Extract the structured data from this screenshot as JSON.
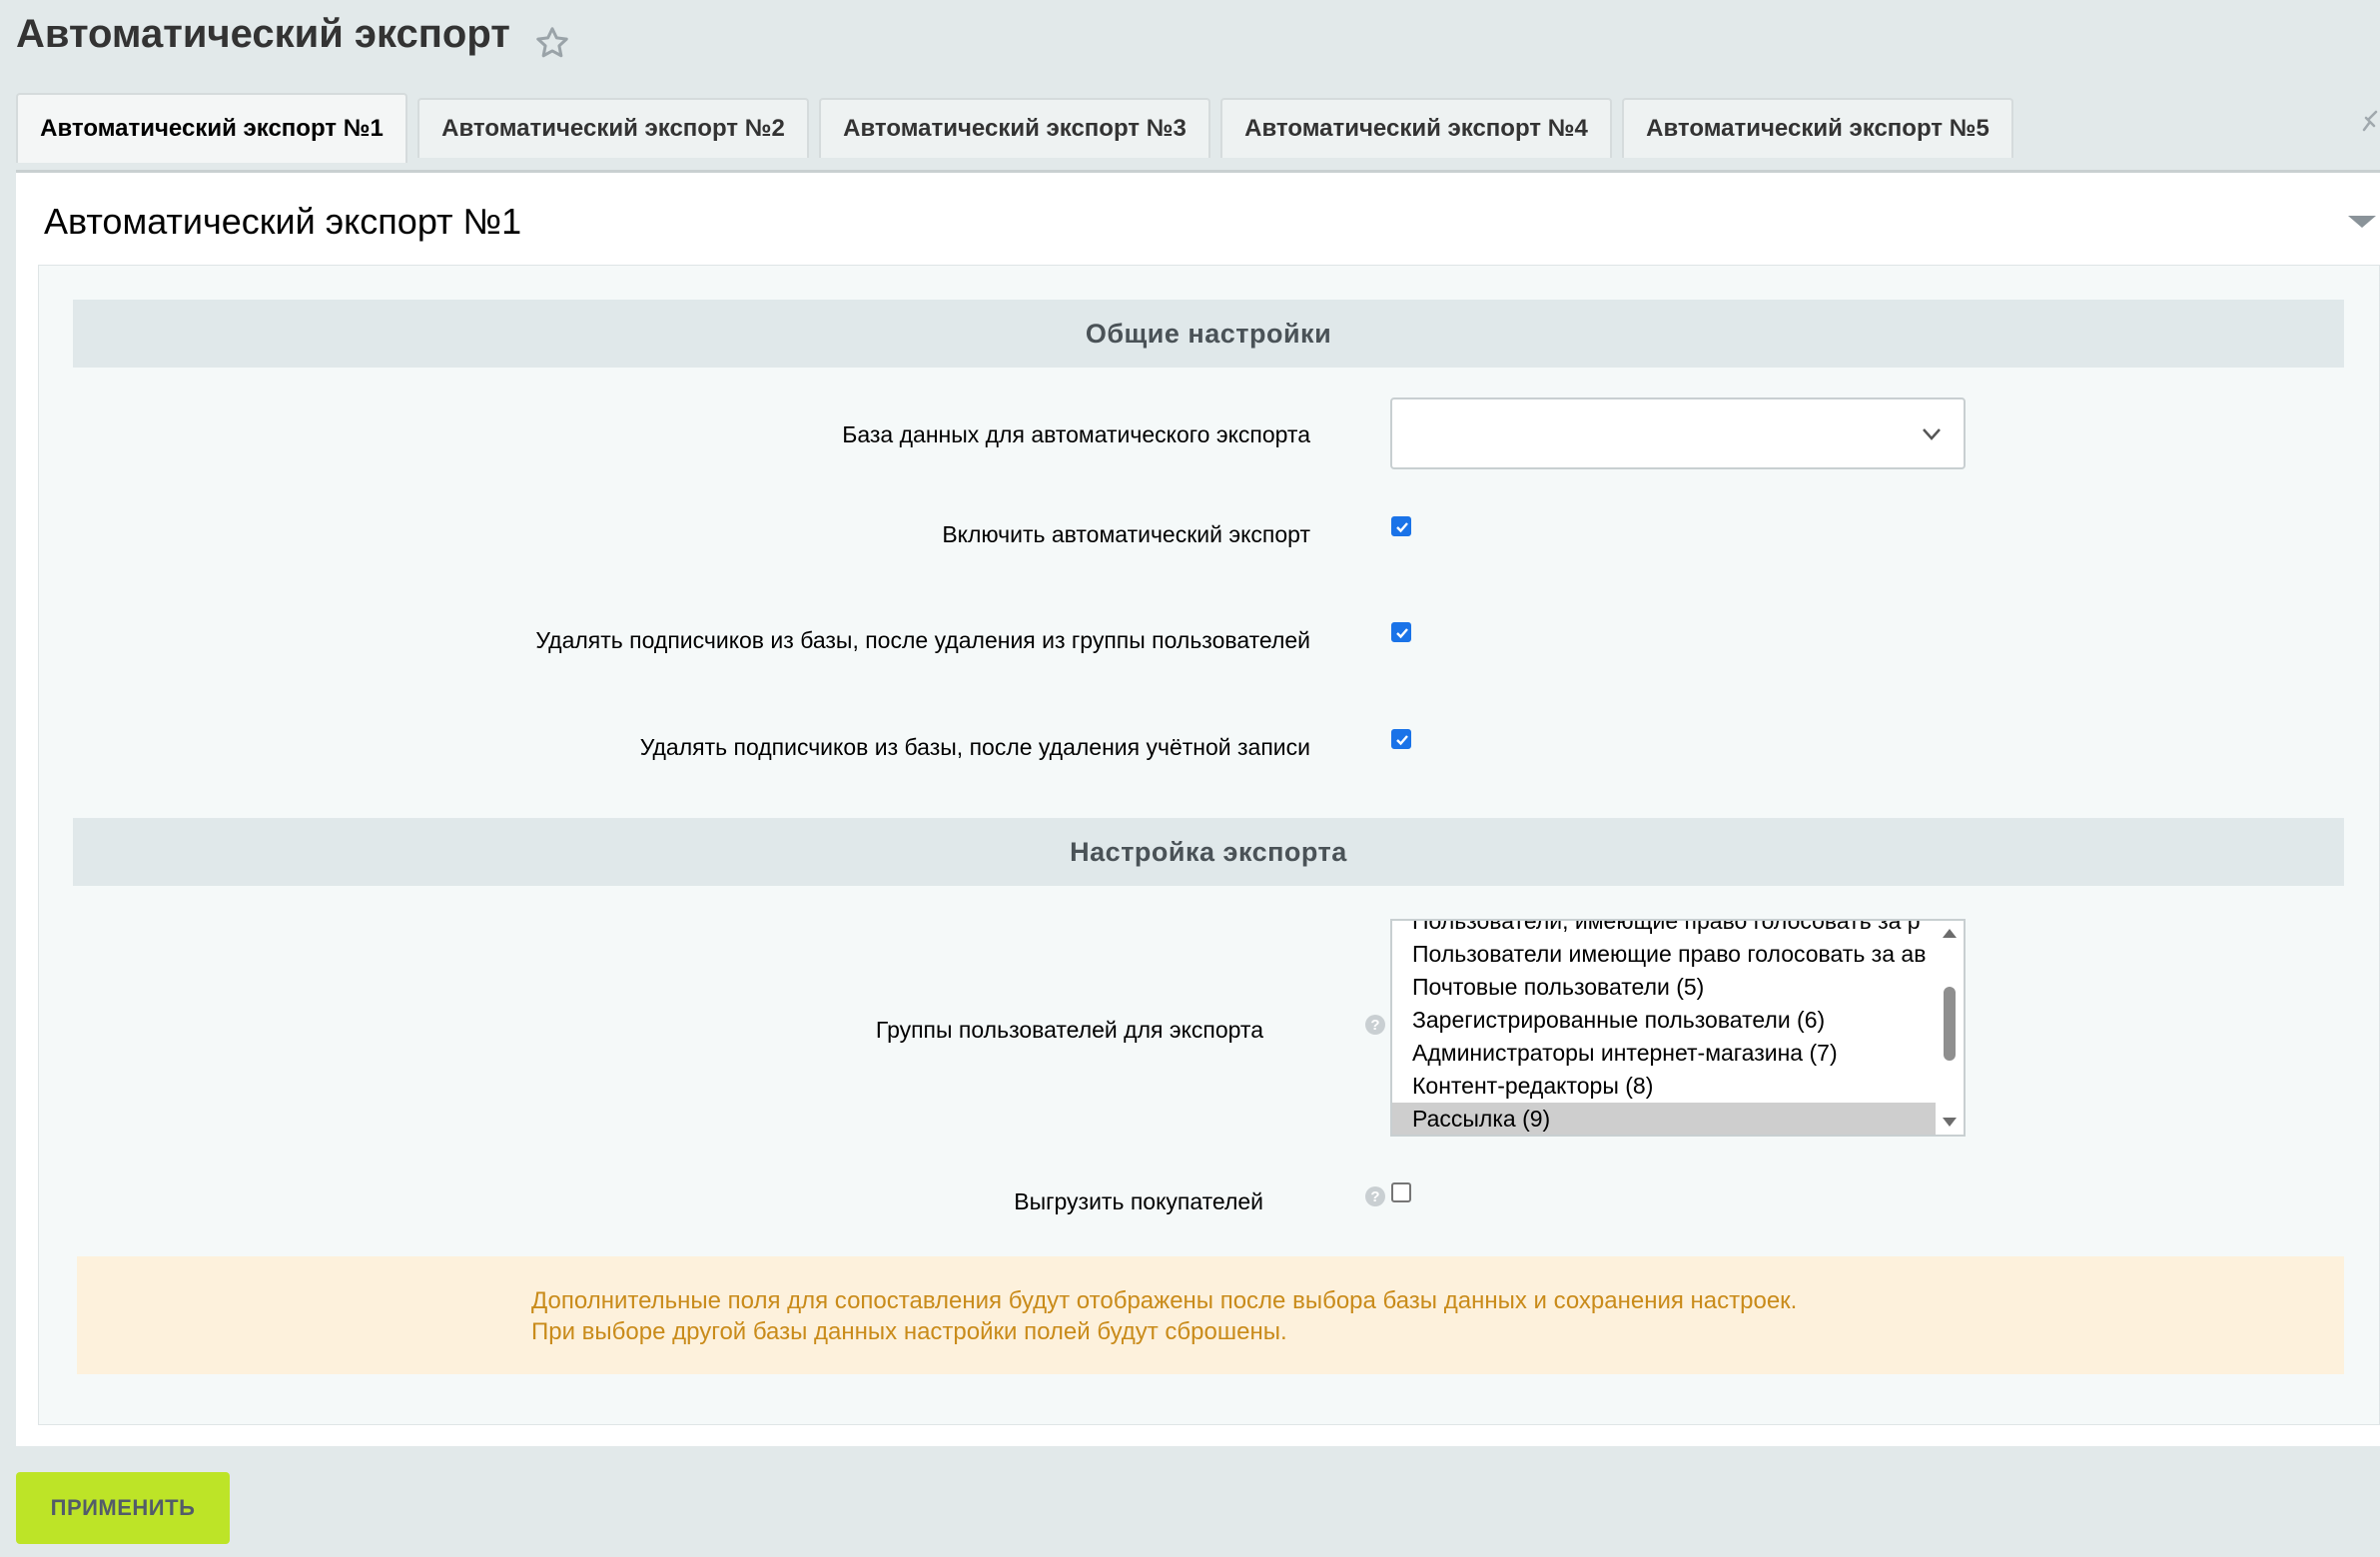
{
  "page": {
    "title": "Автоматический экспорт"
  },
  "tabs": [
    {
      "label": "Автоматический экспорт №1",
      "active": true
    },
    {
      "label": "Автоматический экспорт №2",
      "active": false
    },
    {
      "label": "Автоматический экспорт №3",
      "active": false
    },
    {
      "label": "Автоматический экспорт №4",
      "active": false
    },
    {
      "label": "Автоматический экспорт №5",
      "active": false
    }
  ],
  "panel": {
    "title": "Автоматический экспорт №1",
    "sections": {
      "general": "Общие настройки",
      "export": "Настройка экспорта"
    },
    "fields": {
      "database": {
        "label": "База данных для автоматического экспорта",
        "value": ""
      },
      "enable_export": {
        "label": "Включить автоматический экспорт",
        "checked": true
      },
      "delete_on_group_removal": {
        "label": "Удалять подписчиков из базы, после удаления из группы пользователей",
        "checked": true
      },
      "delete_on_account_removal": {
        "label": "Удалять подписчиков из базы, после удаления учётной записи",
        "checked": true
      },
      "user_groups": {
        "label": "Группы пользователей для экспорта",
        "help": "?",
        "options": [
          "Пользователи, имеющие право голосовать за р",
          "Пользователи имеющие право голосовать за ав",
          "Почтовые пользователи (5)",
          "Зарегистрированные пользователи (6)",
          "Администраторы интернет-магазина (7)",
          "Контент-редакторы (8)",
          "Рассылка (9)"
        ],
        "selected": "Рассылка (9)"
      },
      "export_buyers": {
        "label": "Выгрузить покупателей",
        "help": "?",
        "checked": false
      }
    },
    "notice": {
      "line1": "Дополнительные поля для сопоставления будут отображены после выбора базы данных и сохранения настроек.",
      "line2": "При выборе другой базы данных настройки полей будут сброшены."
    }
  },
  "actions": {
    "apply_label": "ПРИМЕНИТЬ"
  },
  "colors": {
    "apply_button": "#bde427",
    "checkbox": "#1a73e8",
    "notice_text": "#c98b1a",
    "notice_bg": "#fdf1dc"
  },
  "icons": [
    "star-icon",
    "pin-icon",
    "collapse-icon",
    "chevron-down-icon",
    "help-icon",
    "check-icon"
  ]
}
